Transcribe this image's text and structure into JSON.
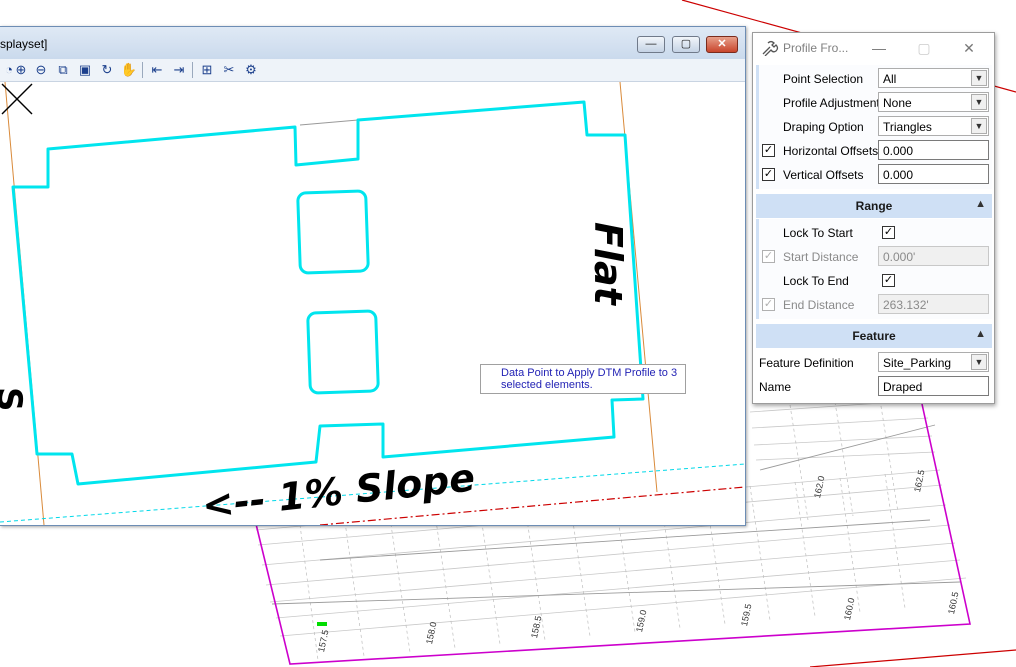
{
  "view_window": {
    "title": "splayset]",
    "buttons": {
      "minimize": "—",
      "maximize": "▢",
      "close": "✕"
    },
    "tools": [
      "zoom-in-icon",
      "zoom-out-icon",
      "window-area-icon",
      "fit-view-icon",
      "rotate-view-icon",
      "pan-view-icon",
      "previous-view-icon",
      "next-view-icon",
      "copy-view-icon",
      "clip-volume-icon",
      "view-attributes-icon"
    ],
    "canvas": {
      "slope_label": "<-- 1% Slope",
      "flat_label": "Flat",
      "tooltip": "Data Point to Apply DTM Profile to 3 selected elements."
    }
  },
  "dialog": {
    "title": "Profile Fro...",
    "controls": {
      "minimize": "—",
      "maximize": "▢",
      "close": "✕"
    },
    "fields": {
      "point_selection": {
        "label": "Point Selection",
        "value": "All"
      },
      "profile_adjustment": {
        "label": "Profile Adjustment",
        "value": "None"
      },
      "draping_option": {
        "label": "Draping Option",
        "value": "Triangles"
      },
      "horizontal_offsets": {
        "label": "Horizontal Offsets",
        "checked": true,
        "value": "0.000"
      },
      "vertical_offsets": {
        "label": "Vertical Offsets",
        "checked": true,
        "value": "0.000"
      }
    },
    "range": {
      "header": "Range",
      "lock_to_start": {
        "label": "Lock To Start",
        "checked": true
      },
      "start_distance": {
        "label": "Start Distance",
        "value": "0.000'",
        "enabled": false
      },
      "lock_to_end": {
        "label": "Lock To End",
        "checked": true
      },
      "end_distance": {
        "label": "End Distance",
        "value": "263.132'",
        "enabled": false
      }
    },
    "feature": {
      "header": "Feature",
      "feature_definition": {
        "label": "Feature Definition",
        "value": "Site_Parking"
      },
      "name": {
        "label": "Name",
        "value": "Draped"
      }
    }
  },
  "background_ticks": [
    "157.5",
    "158.0",
    "158.5",
    "159.0",
    "159.5",
    "160.0",
    "160.5",
    "162.0",
    "162.5"
  ],
  "colors": {
    "outline": "#00e5ee",
    "grid": "#c0c0c0",
    "boundary": "#cc00cc",
    "redline": "#cc0000"
  }
}
